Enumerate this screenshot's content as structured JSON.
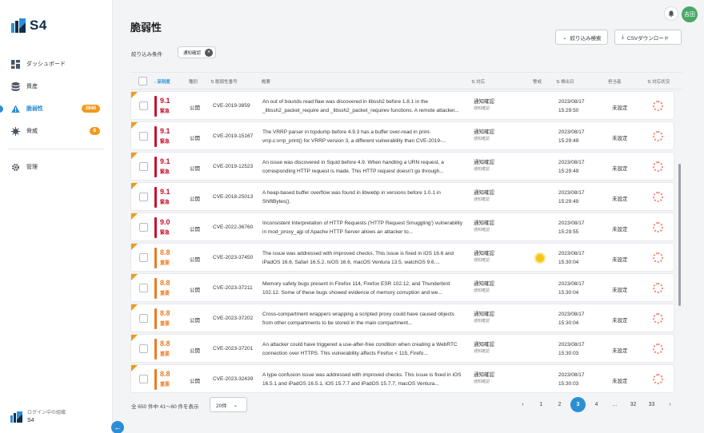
{
  "brand": {
    "name": "S4"
  },
  "sidebar": {
    "items": [
      {
        "label": "ダッシュボード",
        "icon": "dashboard-icon"
      },
      {
        "label": "資産",
        "icon": "database-icon"
      },
      {
        "label": "脆弱性",
        "icon": "warning-icon",
        "badge": "3840",
        "active": true
      },
      {
        "label": "脅威",
        "icon": "virus-icon",
        "badge": "8"
      },
      {
        "label": "管理",
        "icon": "gear-icon"
      }
    ],
    "org_label": "ログイン中の組織",
    "org_name": "S4"
  },
  "header": {
    "avatar_text": "吉田"
  },
  "page": {
    "title": "脆弱性",
    "filter_search_label": "絞り込み検索",
    "csv_download_label": "CSVダウンロード",
    "filter_label": "絞り込み条件",
    "filter_chip": "通知確認"
  },
  "table": {
    "headers": {
      "severity": "深刻度",
      "type": "種別",
      "vuln_id": "脆弱性番号",
      "summary": "概要",
      "status": "対応",
      "importance": "警戒",
      "detected": "検出日",
      "assignee": "担当者",
      "progress": "対応状況"
    },
    "rows": [
      {
        "score": "9.1",
        "level": "緊急",
        "type": "公開",
        "cve": "CVE-2019-3859",
        "desc": "An out of bounds read flaw was discovered in libssh2 before 1.8.1 in the _libssh2_packet_require and _libssh2_packet_requirev functions. A remote attacker...",
        "status": "通知確認",
        "status_sub": "通知確認",
        "date": "2023/08/17",
        "time": "15:29:50",
        "assignee": "未設定",
        "flag": false
      },
      {
        "score": "9.1",
        "level": "緊急",
        "type": "公開",
        "cve": "CVE-2019-15167",
        "desc": "The VRRP parser in tcpdump before 4.9.3 has a buffer over-read in print-vrrp.c:vrrp_print() for VRRP version 3, a different vulnerability than CVE-2019-...",
        "status": "通知確認",
        "status_sub": "通知確認",
        "date": "2023/08/17",
        "time": "15:29:49",
        "assignee": "未設定",
        "flag": false
      },
      {
        "score": "9.1",
        "level": "緊急",
        "type": "公開",
        "cve": "CVE-2019-12523",
        "desc": "An issue was discovered in Squid before 4.9. When handling a URN request, a corresponding HTTP request is made. This HTTP request doesn't go through...",
        "status": "通知確認",
        "status_sub": "通知確認",
        "date": "2023/08/17",
        "time": "15:29:49",
        "assignee": "未設定",
        "flag": false
      },
      {
        "score": "9.1",
        "level": "緊急",
        "type": "公開",
        "cve": "CVE-2018-25013",
        "desc": "A heap-based buffer overflow was found in libwebp in versions before 1.0.1 in ShiftBytes().",
        "status": "通知確認",
        "status_sub": "通知確認",
        "date": "2023/08/17",
        "time": "15:29:49",
        "assignee": "未設定",
        "flag": false
      },
      {
        "score": "9.0",
        "level": "緊急",
        "type": "公開",
        "cve": "CVE-2022-36760",
        "desc": "Inconsistent Interpretation of HTTP Requests ('HTTP Request Smuggling') vulnerability in mod_proxy_ajp of Apache HTTP Server allows an attacker to...",
        "status": "通知確認",
        "status_sub": "通知確認",
        "date": "2023/08/17",
        "time": "15:29:55",
        "assignee": "未設定",
        "flag": false
      },
      {
        "score": "8.8",
        "level": "重要",
        "type": "公開",
        "cve": "CVE-2023-37450",
        "desc": "The issue was addressed with improved checks. This issue is fixed in iOS 16.6 and iPadOS 16.6, Safari 16.5.2, tvOS 16.6, macOS Ventura 13.5, watchOS 9.6....",
        "status": "通知確認",
        "status_sub": "通知確認",
        "date": "2023/08/17",
        "time": "15:30:04",
        "assignee": "未設定",
        "flag": true
      },
      {
        "score": "8.8",
        "level": "重要",
        "type": "公開",
        "cve": "CVE-2023-37211",
        "desc": "Memory safety bugs present in Firefox 114, Firefox ESR 102.12, and Thunderbird 102.12. Some of these bugs showed evidence of memory corruption and we...",
        "status": "通知確認",
        "status_sub": "通知確認",
        "date": "2023/08/17",
        "time": "15:30:04",
        "assignee": "未設定",
        "flag": false
      },
      {
        "score": "8.8",
        "level": "重要",
        "type": "公開",
        "cve": "CVE-2023-37202",
        "desc": "Cross-compartment wrappers wrapping a scripted proxy could have caused objects from other compartments to be stored in the main compartment...",
        "status": "通知確認",
        "status_sub": "通知確認",
        "date": "2023/08/17",
        "time": "15:30:04",
        "assignee": "未設定",
        "flag": false
      },
      {
        "score": "8.8",
        "level": "重要",
        "type": "公開",
        "cve": "CVE-2023-37201",
        "desc": "An attacker could have triggered a use-after-free condition when creating a WebRTC connection over HTTPS. This vulnerability affects Firefox < 115, Firefo...",
        "status": "通知確認",
        "status_sub": "通知確認",
        "date": "2023/08/17",
        "time": "15:30:03",
        "assignee": "未設定",
        "flag": false
      },
      {
        "score": "8.8",
        "level": "重要",
        "type": "公開",
        "cve": "CVE-2023-32439",
        "desc": "A type confusion issue was addressed with improved checks. This issue is fixed in iOS 16.5.1 and iPadOS 16.5.1, iOS 15.7.7 and iPadOS 15.7.7, macOS Ventura...",
        "status": "通知確認",
        "status_sub": "通知確認",
        "date": "2023/08/17",
        "time": "15:30:03",
        "assignee": "未設定",
        "flag": false
      }
    ]
  },
  "footer": {
    "count_text": "全 650 件中 41〜60 件を表示",
    "per_page": "20件",
    "pages": [
      "1",
      "2",
      "3",
      "4",
      "...",
      "32",
      "33"
    ],
    "current_page": "3"
  },
  "colors": {
    "accent": "#2c8fd6",
    "critical": "#c8102e",
    "high": "#ee7a22",
    "badge": "#f09a1d"
  }
}
